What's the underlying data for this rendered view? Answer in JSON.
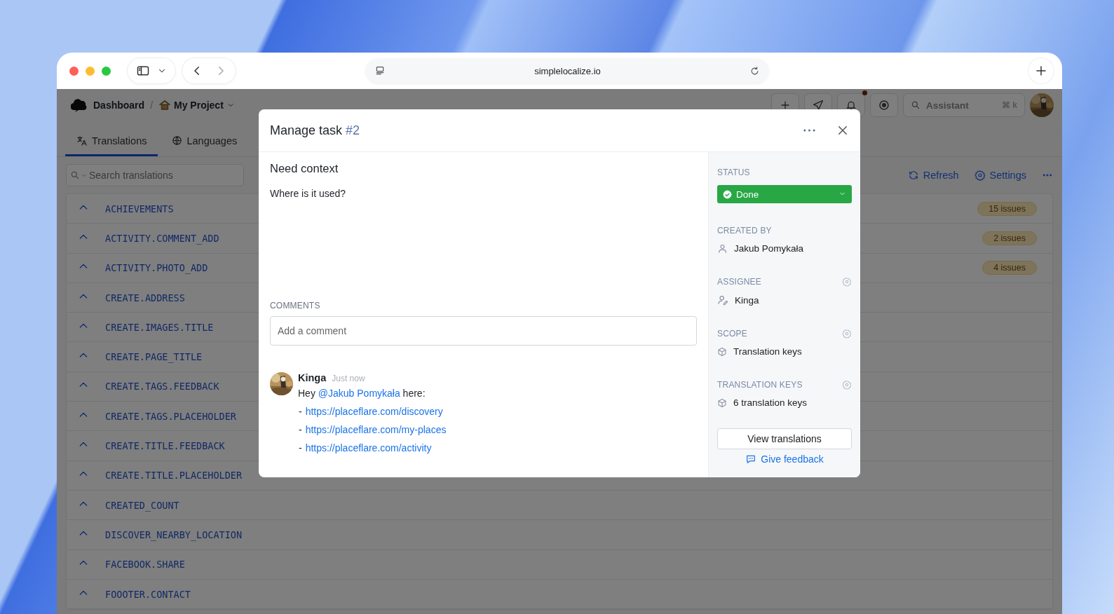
{
  "browser": {
    "url": "simplelocalize.io"
  },
  "header": {
    "breadcrumbs": [
      {
        "label": "Dashboard"
      },
      {
        "label": "My Project"
      }
    ],
    "separator": "/",
    "assistant": {
      "placeholder": "Assistant",
      "shortcut": "⌘ k"
    },
    "notification_dot": true
  },
  "tabs": [
    {
      "label": "Translations",
      "selected": true
    },
    {
      "label": "Languages",
      "selected": false
    }
  ],
  "toolbar": {
    "search": {
      "placeholder": "Search translations"
    },
    "actions": [
      "Refresh",
      "Settings"
    ]
  },
  "keys": [
    {
      "key": "ACHIEVEMENTS",
      "issues": "15 issues"
    },
    {
      "key": "ACTIVITY.COMMENT_ADD",
      "issues": "2 issues"
    },
    {
      "key": "ACTIVITY.PHOTO_ADD",
      "issues": "4 issues"
    },
    {
      "key": "CREATE.ADDRESS"
    },
    {
      "key": "CREATE.IMAGES.TITLE"
    },
    {
      "key": "CREATE.PAGE_TITLE"
    },
    {
      "key": "CREATE.TAGS.FEEDBACK"
    },
    {
      "key": "CREATE.TAGS.PLACEHOLDER"
    },
    {
      "key": "CREATE.TITLE.FEEDBACK"
    },
    {
      "key": "CREATE.TITLE.PLACEHOLDER"
    },
    {
      "key": "CREATED_COUNT"
    },
    {
      "key": "DISCOVER_NEARBY_LOCATION"
    },
    {
      "key": "FACEBOOK.SHARE"
    },
    {
      "key": "FOOOTER.CONTACT"
    }
  ],
  "modal": {
    "title": "Manage task",
    "number": "#2",
    "task_title": "Need context",
    "description": "Where is it used?",
    "comments_label": "COMMENTS",
    "comment_field": {
      "placeholder": "Add a comment"
    },
    "comments": [
      {
        "author": "Kinga",
        "time": "Just now",
        "text": "Hey ",
        "mention": "@Jakub Pomykała",
        "text_after": " here:",
        "links": [
          {
            "bullet": "-",
            "url": "https://placeflare.com/discovery"
          },
          {
            "bullet": "-",
            "url": "https://placeflare.com/my-places"
          },
          {
            "bullet": "-",
            "url": "https://placeflare.com/activity"
          }
        ]
      }
    ],
    "sidebar": [
      {
        "label": "STATUS",
        "kind": "status",
        "value": "Done",
        "settings": false
      },
      {
        "label": "CREATED BY",
        "kind": "person",
        "value": "Jakub Pomykała",
        "settings": false
      },
      {
        "label": "ASSIGNEE",
        "kind": "assignee",
        "value": "Kinga",
        "settings": true
      },
      {
        "label": "SCOPE",
        "kind": "cube",
        "value": "Translation keys",
        "settings": true
      },
      {
        "label": "TRANSLATION KEYS",
        "kind": "cube",
        "value": "6 translation keys",
        "settings": true
      }
    ],
    "view_button": "View translations",
    "feedback_link": "Give feedback"
  }
}
